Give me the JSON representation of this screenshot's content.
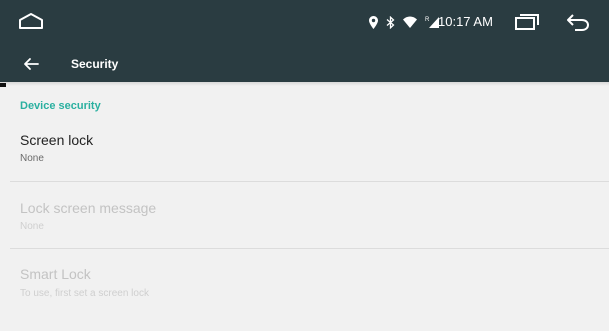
{
  "status_bar": {
    "time": "10:17 AM",
    "icons": [
      "location-icon",
      "bluetooth-icon",
      "wifi-icon",
      "signal-icon"
    ]
  },
  "app_bar": {
    "title": "Security"
  },
  "sections": [
    {
      "header": "Device security",
      "items": [
        {
          "title": "Screen lock",
          "summary": "None",
          "enabled": true
        },
        {
          "title": "Lock screen message",
          "summary": "None",
          "enabled": false
        },
        {
          "title": "Smart Lock",
          "summary": "To use, first set a screen lock",
          "enabled": false
        }
      ]
    }
  ],
  "colors": {
    "toolbar": "#2a3c41",
    "accent": "#2ab0a0",
    "background": "#f1f1f1"
  }
}
